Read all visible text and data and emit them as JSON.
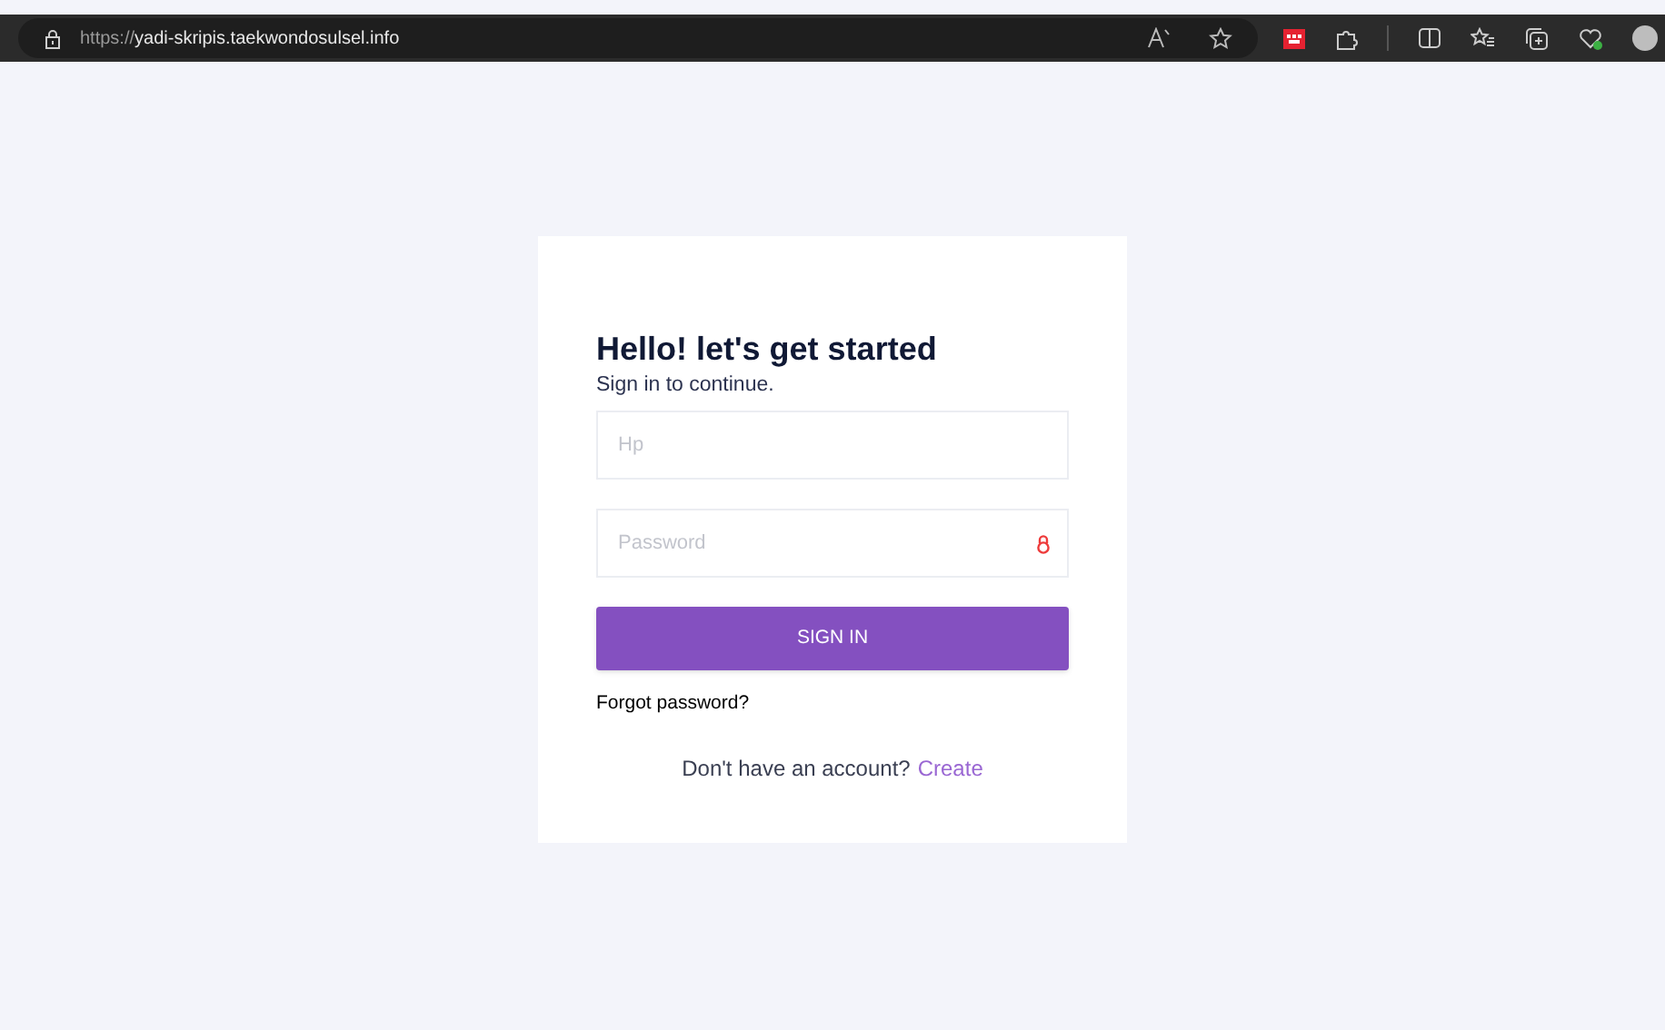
{
  "browser": {
    "url_scheme": "https://",
    "url_host": "yadi-skripis.taekwondosulsel.info"
  },
  "login": {
    "title": "Hello! let's get started",
    "subtitle": "Sign in to continue.",
    "fields": [
      {
        "kind": "text",
        "placeholder": "Hp"
      },
      {
        "kind": "password",
        "placeholder": "Password"
      }
    ],
    "submit": "SIGN IN",
    "forgot": "Forgot password?",
    "signup_prompt": "Don't have an account?",
    "signup_link": "Create"
  }
}
